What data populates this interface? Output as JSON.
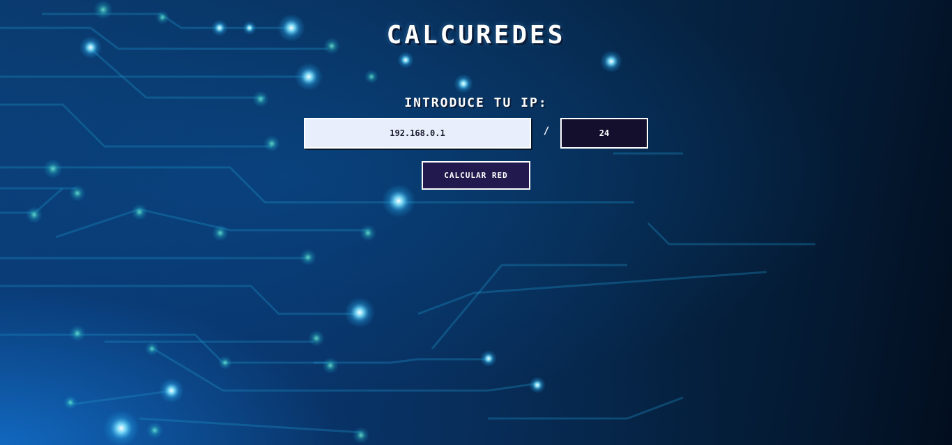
{
  "app": {
    "title": "CALCUREDES"
  },
  "form": {
    "ip_label": "INTRODUCE TU IP:",
    "ip_value": "192.168.0.1",
    "separator": "/",
    "mask_value": "24",
    "submit_label": "CALCULAR RED"
  },
  "theme": {
    "background_primary": "#08305c",
    "background_dark": "#020e1e",
    "circuit_color": "#1a9ad8",
    "node_glow": "#5fd8ff",
    "input_ip_bg": "#e8eefc",
    "input_mask_bg": "#130f2c",
    "button_bg": "#221a4f",
    "text_color": "#ffffff"
  }
}
